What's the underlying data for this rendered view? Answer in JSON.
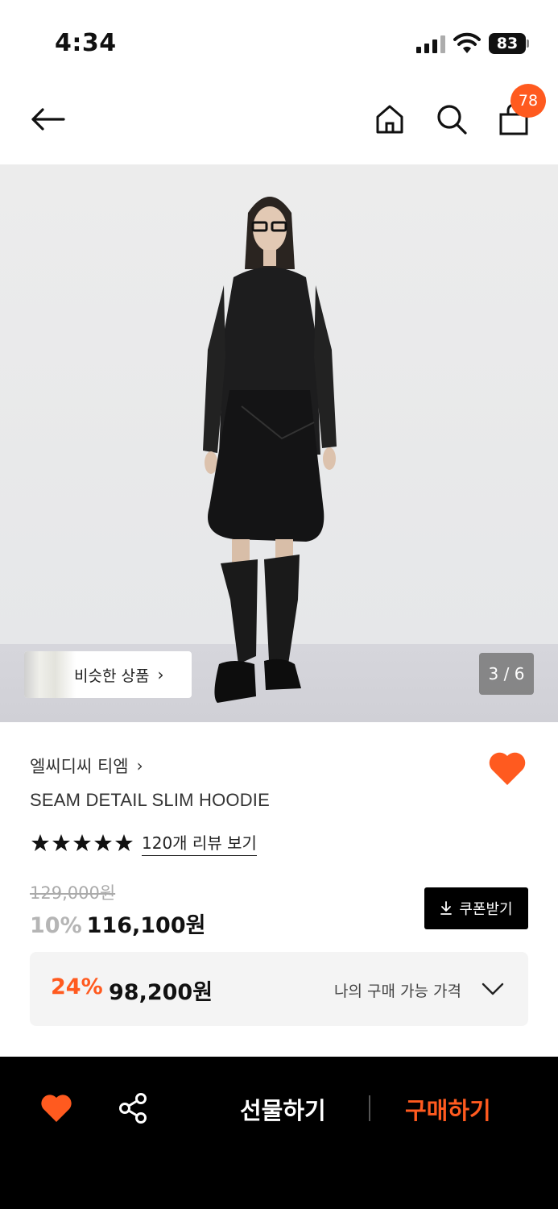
{
  "status_bar": {
    "time": "4:34",
    "battery": "83"
  },
  "nav": {
    "cart_badge": "78"
  },
  "hero": {
    "similar_label": "비슷한 상품",
    "page_indicator": "3 / 6"
  },
  "product": {
    "brand": "엘씨디씨 티엠",
    "name": "SEAM DETAIL SLIM HOODIE",
    "rating_stars": 5,
    "review_link": "120개 리뷰 보기",
    "original_price": "129,000원",
    "discount_rate": "10%",
    "sale_price": "116,100원",
    "coupon_label": "쿠폰받기"
  },
  "my_price": {
    "discount_rate": "24%",
    "price": "98,200원",
    "label": "나의 구매 가능 가격"
  },
  "bottom_bar": {
    "gift_label": "선물하기",
    "buy_label": "구매하기"
  },
  "colors": {
    "accent": "#ff5a1f",
    "bar": "#000000"
  },
  "icons": [
    "back-arrow-icon",
    "home-icon",
    "search-icon",
    "cart-icon",
    "heart-icon",
    "star-icon",
    "download-icon",
    "chevron-down-icon",
    "share-icon"
  ]
}
